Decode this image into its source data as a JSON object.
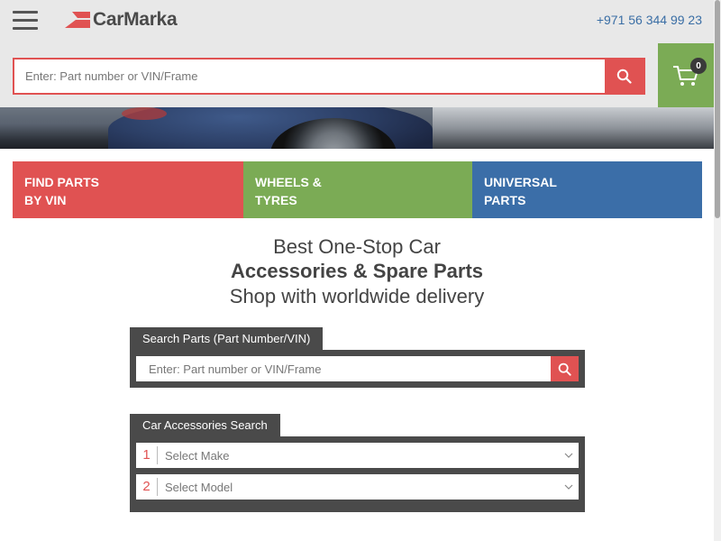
{
  "header": {
    "logo_text": "CarMarka",
    "phone": "+971 56 344 99 23"
  },
  "top_search": {
    "placeholder": "Enter: Part number or VIN/Frame",
    "value": ""
  },
  "cart": {
    "count": "0"
  },
  "tiles": [
    {
      "line1": "FIND PARTS",
      "line2": "BY VIN",
      "color": "#e05252"
    },
    {
      "line1": "WHEELS &",
      "line2": "TYRES",
      "color": "#7bab55"
    },
    {
      "line1": "UNIVERSAL",
      "line2": "PARTS",
      "color": "#3b6ea8"
    }
  ],
  "headline": {
    "line1": "Best One-Stop Car",
    "line2": "Accessories & Spare Parts",
    "line3": "Shop with worldwide delivery"
  },
  "parts_search": {
    "tab_label": "Search Parts (Part Number/VIN)",
    "placeholder": "Enter: Part number or VIN/Frame",
    "value": ""
  },
  "accessories_search": {
    "tab_label": "Car Accessories Search",
    "selects": [
      {
        "num": "1",
        "label": "Select Make"
      },
      {
        "num": "2",
        "label": "Select Model"
      }
    ]
  },
  "colors": {
    "accent_red": "#e05252",
    "accent_green": "#7bab55",
    "accent_blue": "#3b6ea8",
    "dark_panel": "#4a4a4a"
  }
}
